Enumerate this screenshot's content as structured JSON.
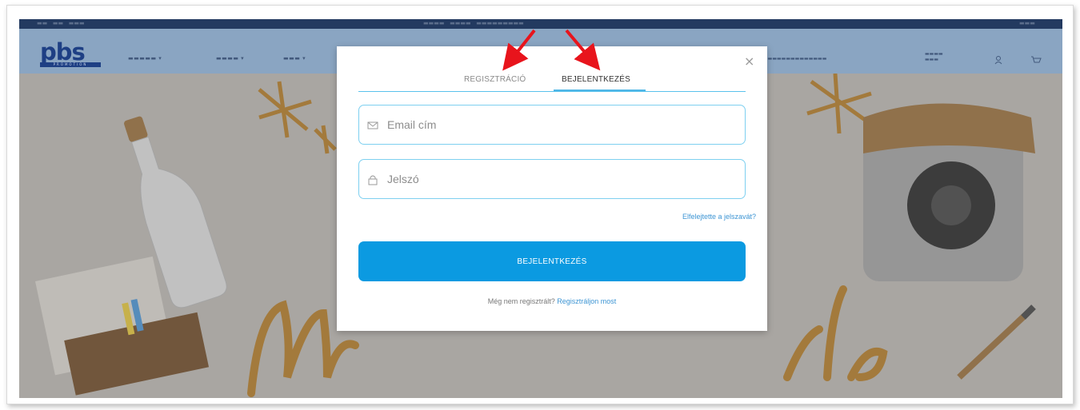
{
  "modal": {
    "tabs": [
      {
        "label": "REGISZTRÁCIÓ",
        "active": false
      },
      {
        "label": "BEJELENTKEZÉS",
        "active": true
      }
    ],
    "close_label": "×",
    "email_placeholder": "Email cím",
    "password_placeholder": "Jelszó",
    "forgot_link": "Elfelejtette a jelszavát?",
    "submit_label": "BEJELENTKEZÉS",
    "register_prompt": "Még nem regisztrált?",
    "register_link": "Regisztráljon most",
    "icons": {
      "email": "envelope-icon",
      "password": "lock-icon",
      "close": "close-icon"
    }
  },
  "colors": {
    "primary_button": "#0b9ae1",
    "field_border": "#7ed0f0",
    "link": "#3d95d4",
    "annotation_arrow": "#e8141c"
  }
}
